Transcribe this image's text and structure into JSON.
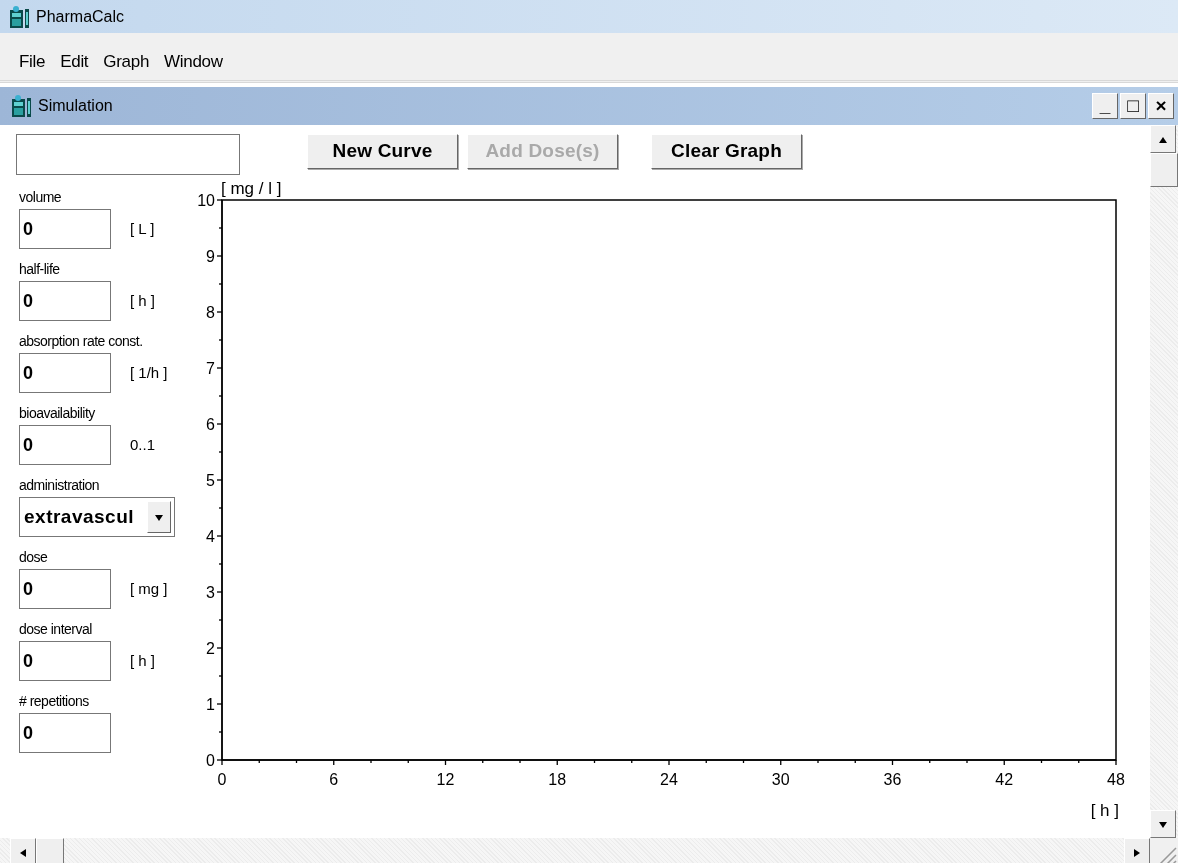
{
  "app": {
    "title": "PharmaCalc"
  },
  "menu": [
    {
      "label": "File"
    },
    {
      "label": "Edit"
    },
    {
      "label": "Graph"
    },
    {
      "label": "Window"
    }
  ],
  "child_window": {
    "title": "Simulation",
    "controls": [
      "_",
      "□",
      "×"
    ]
  },
  "buttons": [
    {
      "label": "New Curve",
      "disabled": false
    },
    {
      "label": "Add Dose(s)",
      "disabled": true
    },
    {
      "label": "Clear Graph",
      "disabled": false
    }
  ],
  "fields": [
    {
      "kind": "input",
      "label": "volume",
      "value": "0",
      "unit": "[ L ]"
    },
    {
      "kind": "input",
      "label": "half-life",
      "value": "0",
      "unit": "[ h ]"
    },
    {
      "kind": "input",
      "label": "absorption rate const.",
      "value": "0",
      "unit": "[ 1/h ]"
    },
    {
      "kind": "input",
      "label": "bioavailability",
      "value": "0",
      "unit": "0..1"
    },
    {
      "kind": "select",
      "label": "administration",
      "value": "extravascul"
    },
    {
      "kind": "input",
      "label": "dose",
      "value": "0",
      "unit": "[ mg ]"
    },
    {
      "kind": "input",
      "label": "dose interval",
      "value": "0",
      "unit": "[ h ]"
    },
    {
      "kind": "input",
      "label": "# repetitions",
      "value": "0"
    }
  ],
  "graph": {
    "chart_data": {
      "type": "line",
      "xlabel": "[ h ]",
      "ylabel": "[ mg / l ]",
      "xlim": [
        0,
        48
      ],
      "ylim": [
        0,
        10
      ],
      "xticks": [
        0,
        6,
        12,
        18,
        24,
        30,
        36,
        42,
        48
      ],
      "yticks": [
        0,
        1,
        2,
        3,
        4,
        5,
        6,
        7,
        8,
        9,
        10
      ]
    }
  }
}
